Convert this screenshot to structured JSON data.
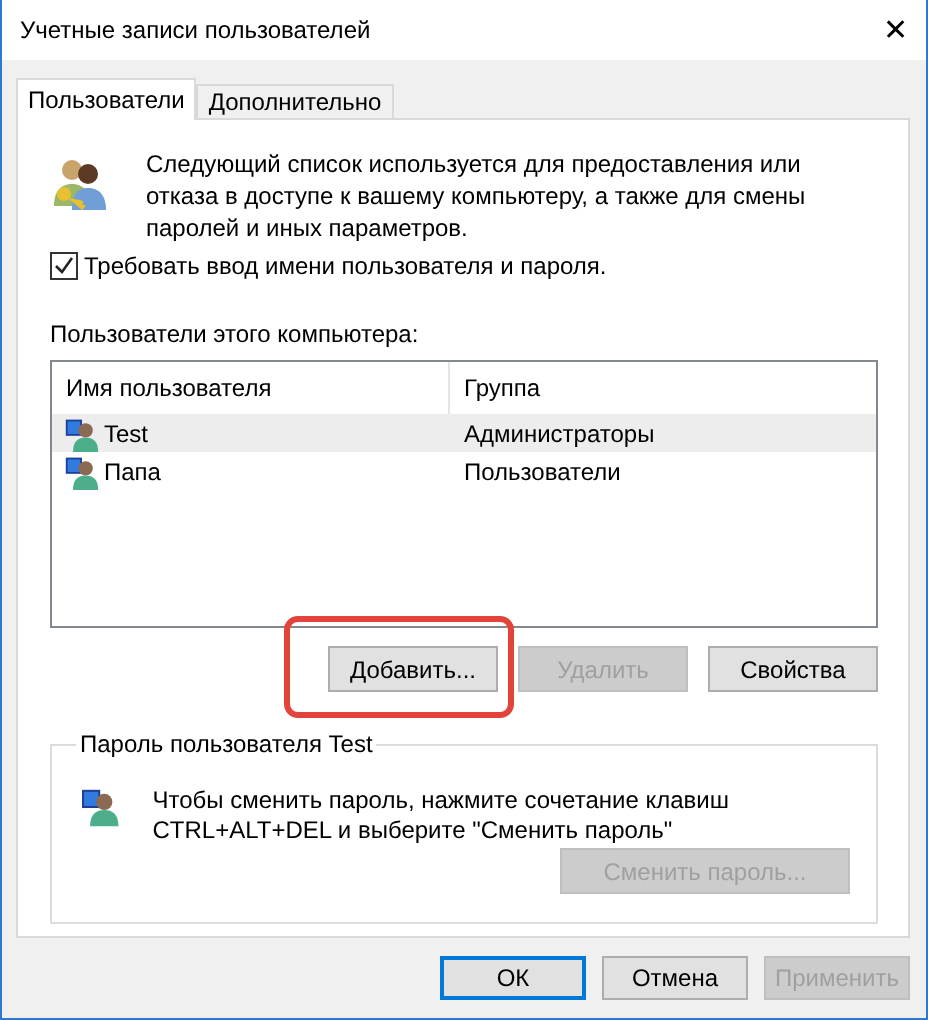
{
  "window": {
    "title": "Учетные записи пользователей",
    "close": "✕"
  },
  "tabs": [
    {
      "label": "Пользователи",
      "selected": true
    },
    {
      "label": "Дополнительно",
      "selected": false
    }
  ],
  "intro": "Следующий список используется для предоставления или отказа в доступе к вашему компьютеру, а также для смены паролей и иных параметров.",
  "require_login": {
    "label": "Требовать ввод имени пользователя и пароля.",
    "checked": true
  },
  "users_label": "Пользователи этого компьютера:",
  "table": {
    "columns": [
      "Имя пользователя",
      "Группа"
    ],
    "rows": [
      {
        "name": "Test",
        "group": "Администраторы",
        "selected": true
      },
      {
        "name": "Папа",
        "group": "Пользователи",
        "selected": false
      }
    ]
  },
  "user_buttons": [
    {
      "label": "Добавить...",
      "disabled": false,
      "highlighted": true
    },
    {
      "label": "Удалить",
      "disabled": true,
      "highlighted": false
    },
    {
      "label": "Свойства",
      "disabled": false,
      "highlighted": false
    }
  ],
  "password_group": {
    "title": "Пароль пользователя Test",
    "text": "Чтобы сменить пароль, нажмите сочетание клавиш CTRL+ALT+DEL и выберите \"Сменить пароль\"",
    "button": {
      "label": "Сменить пароль...",
      "disabled": true
    }
  },
  "dialog_buttons": [
    {
      "label": "ОК",
      "disabled": false,
      "default": true
    },
    {
      "label": "Отмена",
      "disabled": false,
      "default": false
    },
    {
      "label": "Применить",
      "disabled": true,
      "default": false
    }
  ]
}
